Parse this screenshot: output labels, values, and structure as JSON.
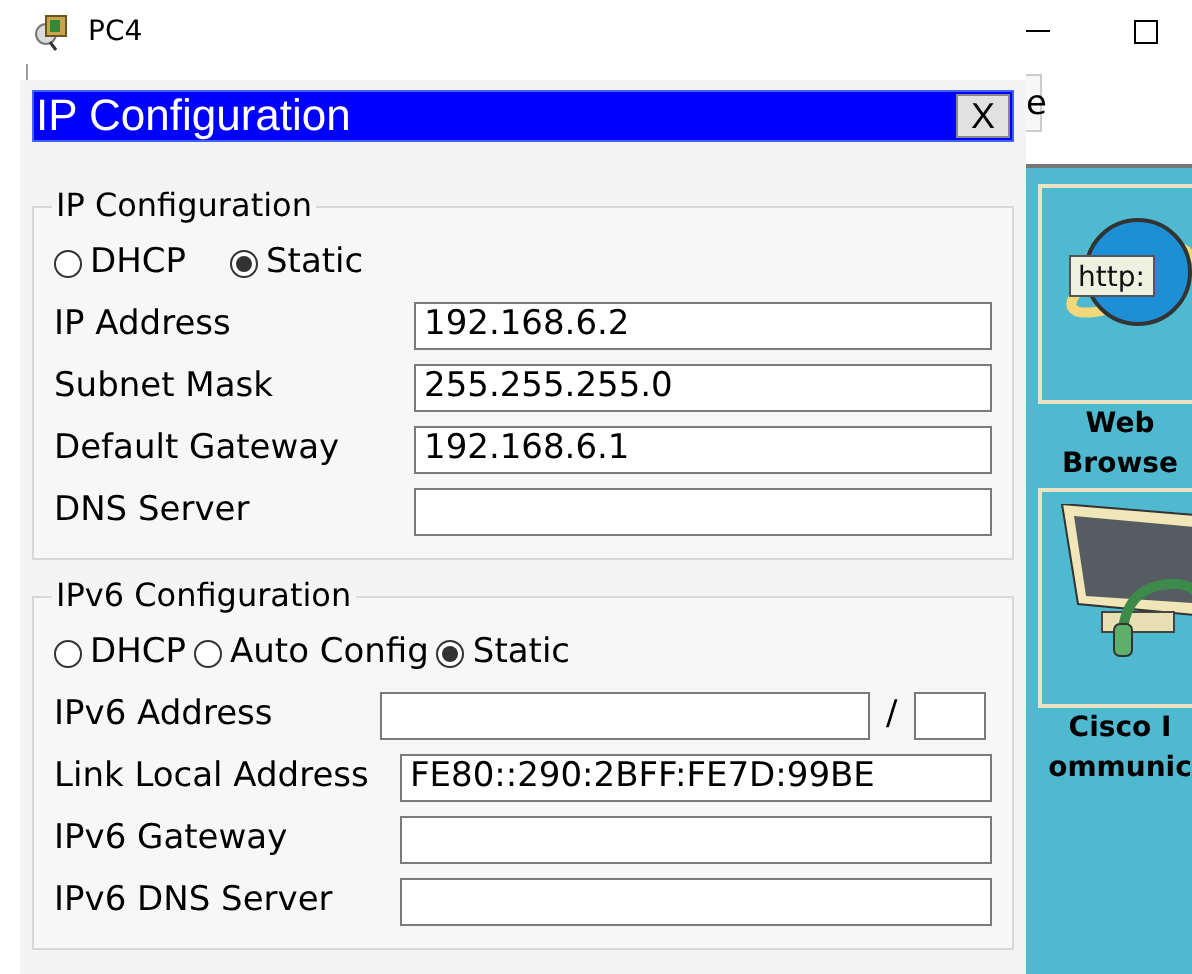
{
  "window": {
    "title": "PC4"
  },
  "background": {
    "tab_fragment": "e",
    "apps": [
      {
        "kind": "web",
        "label_lines": [
          "Web",
          "Browse"
        ],
        "icon_text": "http:"
      },
      {
        "kind": "phone",
        "label_lines": [
          "Cisco I",
          "ommunic"
        ]
      }
    ]
  },
  "dialog": {
    "title": "IP Configuration",
    "close": "X",
    "ipv4": {
      "title": "IP Configuration",
      "modes": [
        {
          "label": "DHCP",
          "selected": false
        },
        {
          "label": "Static",
          "selected": true
        }
      ],
      "fields": [
        {
          "label": "IP Address",
          "value": "192.168.6.2"
        },
        {
          "label": "Subnet Mask",
          "value": "255.255.255.0"
        },
        {
          "label": "Default Gateway",
          "value": "192.168.6.1"
        },
        {
          "label": "DNS Server"
        }
      ]
    },
    "ipv6": {
      "title": "IPv6 Configuration",
      "modes": [
        {
          "label": "DHCP",
          "selected": false
        },
        {
          "label": "Auto Config",
          "selected": false
        },
        {
          "label": "Static",
          "selected": true
        }
      ],
      "address": {
        "label": "IPv6 Address",
        "separator": "/"
      },
      "fields": [
        {
          "label": "Link Local Address",
          "value": "FE80::290:2BFF:FE7D:99BE"
        },
        {
          "label": "IPv6 Gateway"
        },
        {
          "label": "IPv6 DNS Server"
        }
      ]
    }
  }
}
